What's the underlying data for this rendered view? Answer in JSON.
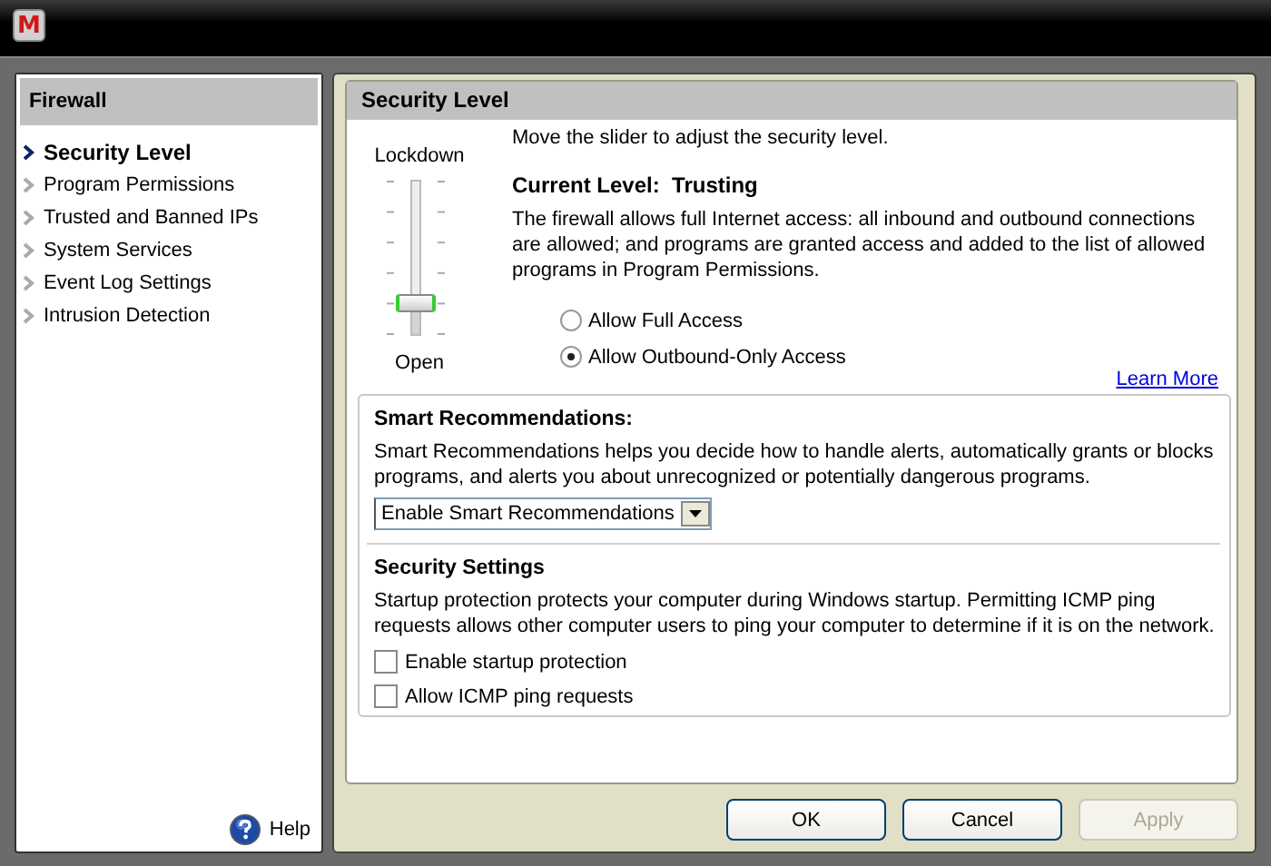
{
  "window": {
    "logo": "M"
  },
  "sidebar": {
    "title": "Firewall",
    "items": [
      {
        "label": "Security Level",
        "selected": true
      },
      {
        "label": "Program Permissions",
        "selected": false
      },
      {
        "label": "Trusted and Banned IPs",
        "selected": false
      },
      {
        "label": "System Services",
        "selected": false
      },
      {
        "label": "Event Log Settings",
        "selected": false
      },
      {
        "label": "Intrusion Detection",
        "selected": false
      }
    ],
    "help": "Help"
  },
  "security_level": {
    "title": "Security Level",
    "instruction": "Move the slider to adjust the security level.",
    "slider": {
      "top_label": "Lockdown",
      "bottom_label": "Open",
      "level": 0.2
    },
    "current_level": "Current Level:  Trusting",
    "description": "The firewall allows full Internet access: all inbound and outbound connections are allowed; and programs are granted access and added to the list of allowed programs in Program Permissions.",
    "radios": [
      {
        "label": "Allow Full Access",
        "selected": false
      },
      {
        "label": "Allow Outbound-Only Access",
        "selected": true
      }
    ],
    "link": "Learn More"
  },
  "smart_recommendations": {
    "title": "Smart Recommendations:",
    "description": "Smart Recommendations helps you decide how to handle alerts, automatically grants or blocks programs, and alerts you about unrecognized or potentially dangerous programs.",
    "dropdown": {
      "value": "Enable Smart Recommendations"
    }
  },
  "security_settings": {
    "title": "Security Settings",
    "description": "Startup protection protects your computer during Windows startup. Permitting ICMP ping requests allows other computer users to ping your computer to determine if it is on the network.",
    "checkboxes": [
      {
        "label": "Enable startup protection",
        "checked": false
      },
      {
        "label": "Allow ICMP ping requests",
        "checked": false
      }
    ]
  },
  "buttons": [
    {
      "label": "OK",
      "disabled": false
    },
    {
      "label": "Cancel",
      "disabled": false
    },
    {
      "label": "Apply",
      "disabled": true
    }
  ]
}
